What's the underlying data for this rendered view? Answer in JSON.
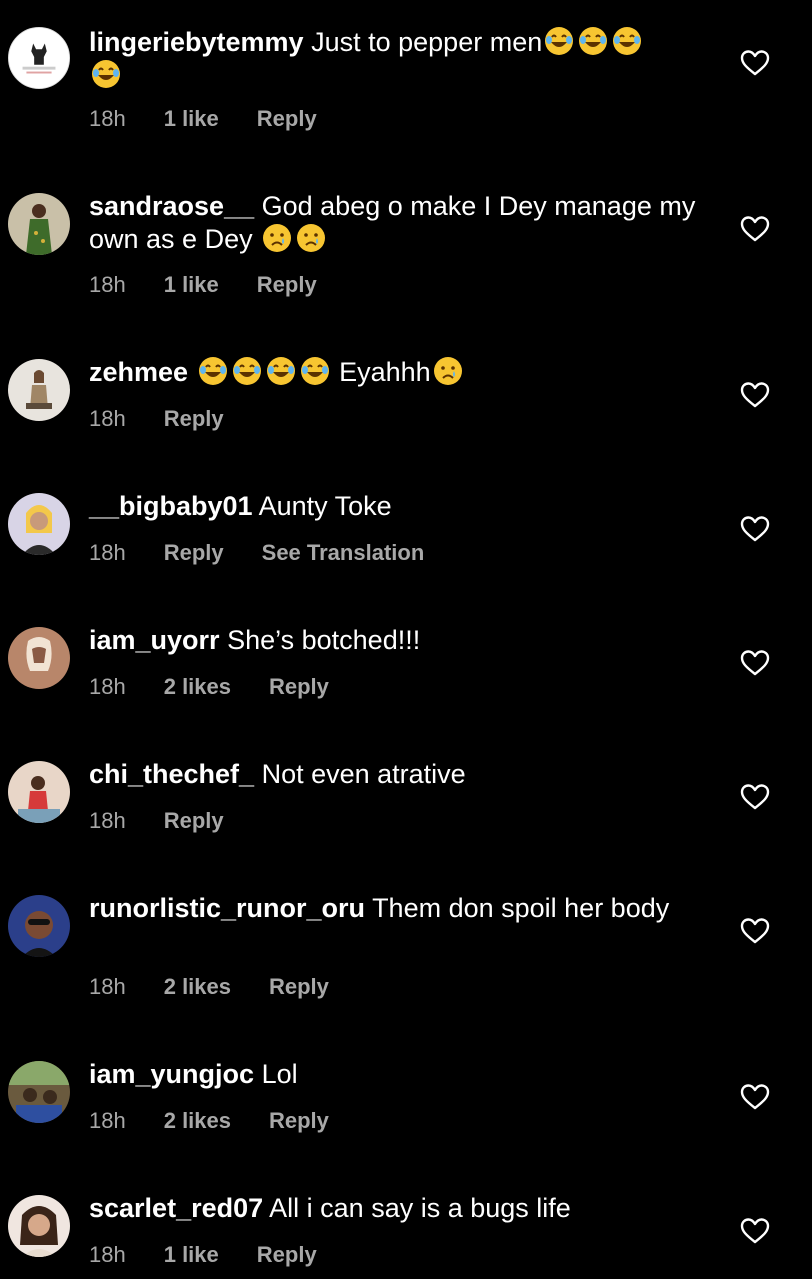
{
  "comments": [
    {
      "username": "lingeriebytemmy",
      "text": "Just to pepper men",
      "emoji_after": [
        "laugh",
        "laugh",
        "laugh",
        "laugh"
      ],
      "time": "18h",
      "likes": "1 like",
      "reply": "Reply",
      "avatar": "lingerie-logo-avatar",
      "avatar_lettering": "lingerie by temmy"
    },
    {
      "username": "sandraose__",
      "text": "God abeg o make I Dey manage my own as e Dey",
      "emoji_after": [
        "cry",
        "cry"
      ],
      "time": "18h",
      "likes": "1 like",
      "reply": "Reply",
      "avatar": "user-photo-avatar"
    },
    {
      "username": "zehmee",
      "text": "",
      "emoji_after": [
        "laugh",
        "laugh",
        "laugh",
        "laugh"
      ],
      "text2": "Eyahhh",
      "emoji_after2": [
        "cry"
      ],
      "time": "18h",
      "likes": "",
      "reply": "Reply",
      "avatar": "user-photo-avatar"
    },
    {
      "username": "__bigbaby01",
      "text": "Aunty Toke",
      "time": "18h",
      "likes": "",
      "reply": "Reply",
      "translate": "See Translation",
      "avatar": "user-photo-avatar"
    },
    {
      "username": "iam_uyorr",
      "text": "She’s botched!!!",
      "time": "18h",
      "likes": "2 likes",
      "reply": "Reply",
      "avatar": "user-photo-avatar"
    },
    {
      "username": "chi_thechef_",
      "text": "Not even atrative",
      "time": "18h",
      "likes": "",
      "reply": "Reply",
      "avatar": "user-photo-avatar"
    },
    {
      "username": "runorlistic_runor_oru",
      "text": "Them don spoil her body",
      "time": "18h",
      "likes": "2 likes",
      "reply": "Reply",
      "avatar": "user-photo-avatar"
    },
    {
      "username": "iam_yungjoc",
      "text": "Lol",
      "time": "18h",
      "likes": "2 likes",
      "reply": "Reply",
      "avatar": "user-photo-avatar"
    },
    {
      "username": "scarlet_red07",
      "text": "All i can say is a bugs life",
      "time": "18h",
      "likes": "1 like",
      "reply": "Reply",
      "avatar": "user-photo-avatar"
    }
  ],
  "colors": {
    "background": "#000000",
    "text": "#ffffff",
    "meta": "#a8a8a8",
    "heart": "#ffffff"
  },
  "icons": {
    "like": "heart-outline-icon",
    "laugh": "face-with-tears-of-joy-emoji",
    "cry": "crying-face-emoji"
  }
}
